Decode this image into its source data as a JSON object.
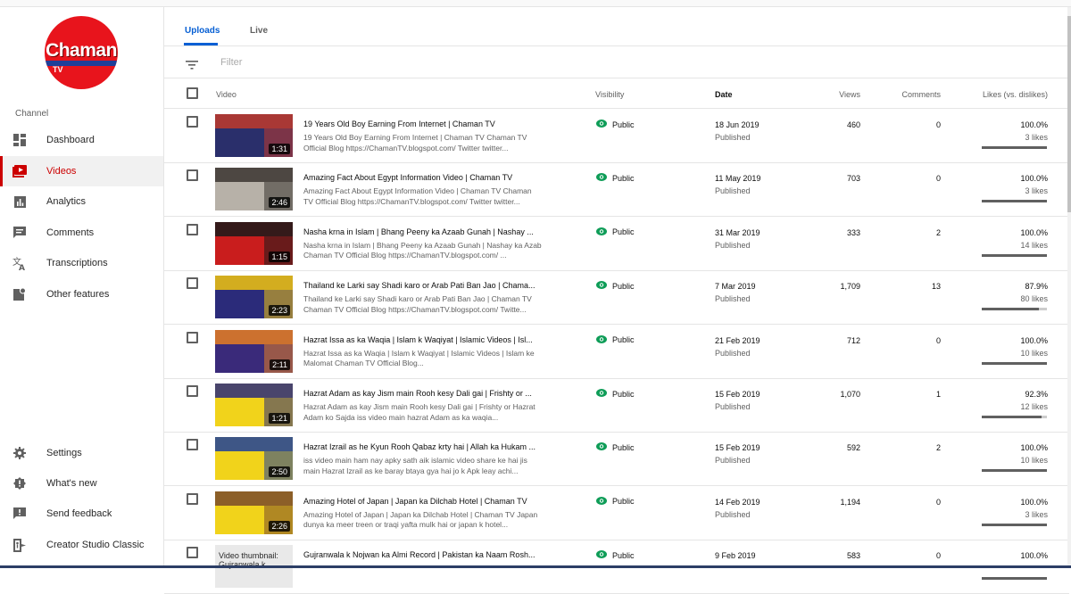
{
  "channel": {
    "logo_text": "Chaman",
    "logo_sub": "TV",
    "section_label": "Channel"
  },
  "sidebar": {
    "items": [
      {
        "label": "Dashboard",
        "icon": "dashboard-icon"
      },
      {
        "label": "Videos",
        "icon": "videos-icon",
        "active": true
      },
      {
        "label": "Analytics",
        "icon": "analytics-icon"
      },
      {
        "label": "Comments",
        "icon": "comments-icon"
      },
      {
        "label": "Transcriptions",
        "icon": "transcriptions-icon"
      },
      {
        "label": "Other features",
        "icon": "other-features-icon"
      }
    ],
    "bottom_items": [
      {
        "label": "Settings",
        "icon": "gear-icon"
      },
      {
        "label": "What's new",
        "icon": "whats-new-icon"
      },
      {
        "label": "Send feedback",
        "icon": "feedback-icon"
      },
      {
        "label": "Creator Studio Classic",
        "icon": "exit-icon"
      }
    ]
  },
  "tabs": [
    {
      "label": "Uploads",
      "active": true
    },
    {
      "label": "Live"
    }
  ],
  "filter": {
    "placeholder": "Filter"
  },
  "table": {
    "headers": {
      "video": "Video",
      "visibility": "Visibility",
      "date": "Date",
      "views": "Views",
      "comments": "Comments",
      "likes": "Likes (vs. dislikes)"
    },
    "rows": [
      {
        "title": "19 Years Old Boy Earning From Internet | Chaman TV",
        "desc": "19 Years Old Boy Earning From Internet | Chaman TV Chaman TV Official Blog https://ChamanTV.blogspot.com/ Twitter twitter...",
        "duration": "1:31",
        "visibility": "Public",
        "date": "18 Jun 2019",
        "status": "Published",
        "views": "460",
        "comments": "0",
        "likes_pct": "100.0%",
        "likes_count": "3 likes",
        "ratio": 1.0,
        "thumb_bg": "#2a2f6b",
        "thumb_accent": "#c0392b"
      },
      {
        "title": "Amazing Fact About Egypt Information Video | Chaman TV",
        "desc": "Amazing Fact About Egypt Information Video | Chaman TV Chaman TV Official Blog https://ChamanTV.blogspot.com/ Twitter twitter...",
        "duration": "2:46",
        "visibility": "Public",
        "date": "11 May 2019",
        "status": "Published",
        "views": "703",
        "comments": "0",
        "likes_pct": "100.0%",
        "likes_count": "3 likes",
        "ratio": 1.0,
        "thumb_bg": "#b7b1a8",
        "thumb_accent": "#3b3530"
      },
      {
        "title": "Nasha krna in Islam | Bhang Peeny ka Azaab Gunah | Nashay ...",
        "desc": "Nasha krna in Islam | Bhang Peeny ka Azaab Gunah | Nashay ka Azab Chaman TV Official Blog https://ChamanTV.blogspot.com/ ...",
        "duration": "1:15",
        "visibility": "Public",
        "date": "31 Mar 2019",
        "status": "Published",
        "views": "333",
        "comments": "2",
        "likes_pct": "100.0%",
        "likes_count": "14 likes",
        "ratio": 1.0,
        "thumb_bg": "#c91d1d",
        "thumb_accent": "#1a1a1a"
      },
      {
        "title": "Thailand ke Larki say Shadi karo or Arab Pati Ban Jao | Chama...",
        "desc": "Thailand ke Larki say Shadi karo or Arab Pati Ban Jao | Chaman TV Chaman TV Official Blog https://ChamanTV.blogspot.com/ Twitte...",
        "duration": "2:23",
        "visibility": "Public",
        "date": "7 Mar 2019",
        "status": "Published",
        "views": "1,709",
        "comments": "13",
        "likes_pct": "87.9%",
        "likes_count": "80 likes",
        "ratio": 0.879,
        "thumb_bg": "#2b2b7a",
        "thumb_accent": "#f1c40f"
      },
      {
        "title": "Hazrat Issa as ka Waqia | Islam k Waqiyat | Islamic Videos | Isl...",
        "desc": "Hazrat Issa as ka Waqia | Islam k Waqiyat | Islamic Videos | Islam ke Malomat Chaman TV Official Blog...",
        "duration": "2:11",
        "visibility": "Public",
        "date": "21 Feb 2019",
        "status": "Published",
        "views": "712",
        "comments": "0",
        "likes_pct": "100.0%",
        "likes_count": "10 likes",
        "ratio": 1.0,
        "thumb_bg": "#3a2a7a",
        "thumb_accent": "#e67e22"
      },
      {
        "title": "Hazrat Adam as kay Jism main Rooh kesy Dali gai | Frishty or ...",
        "desc": "Hazrat Adam as kay Jism main Rooh kesy Dali gai | Frishty or Hazrat Adam ko Sajda iss video main hazrat Adam as ka waqia...",
        "duration": "1:21",
        "visibility": "Public",
        "date": "15 Feb 2019",
        "status": "Published",
        "views": "1,070",
        "comments": "1",
        "likes_pct": "92.3%",
        "likes_count": "12 likes",
        "ratio": 0.923,
        "thumb_bg": "#f1d31b",
        "thumb_accent": "#2b2b7a"
      },
      {
        "title": "Hazrat Izrail as he Kyun Rooh Qabaz krty hai | Allah ka Hukam ...",
        "desc": "iss video main ham nay apky sath aik islamic video share ke hai jis main Hazrat Izrail as ke baray btaya gya hai jo k Apk leay achi...",
        "duration": "2:50",
        "visibility": "Public",
        "date": "15 Feb 2019",
        "status": "Published",
        "views": "592",
        "comments": "2",
        "likes_pct": "100.0%",
        "likes_count": "10 likes",
        "ratio": 1.0,
        "thumb_bg": "#f1d31b",
        "thumb_accent": "#1f3f99"
      },
      {
        "title": "Amazing Hotel of Japan | Japan ka Dilchab Hotel | Chaman TV",
        "desc": "Amazing Hotel of Japan | Japan ka Dilchab Hotel | Chaman TV Japan dunya ka meer treen or traqi yafta mulk hai or japan k hotel...",
        "duration": "2:26",
        "visibility": "Public",
        "date": "14 Feb 2019",
        "status": "Published",
        "views": "1,194",
        "comments": "0",
        "likes_pct": "100.0%",
        "likes_count": "3 likes",
        "ratio": 1.0,
        "thumb_bg": "#f1d31b",
        "thumb_accent": "#7a4a2a"
      },
      {
        "title": "Gujranwala k Nojwan ka Almi Record | Pakistan ka Naam Rosh...",
        "desc": "",
        "duration": "",
        "visibility": "Public",
        "date": "9 Feb 2019",
        "status": "",
        "views": "583",
        "comments": "0",
        "likes_pct": "100.0%",
        "likes_count": "",
        "ratio": 1.0,
        "placeholder": "Video thumbnail: Gujranwala k"
      }
    ]
  }
}
